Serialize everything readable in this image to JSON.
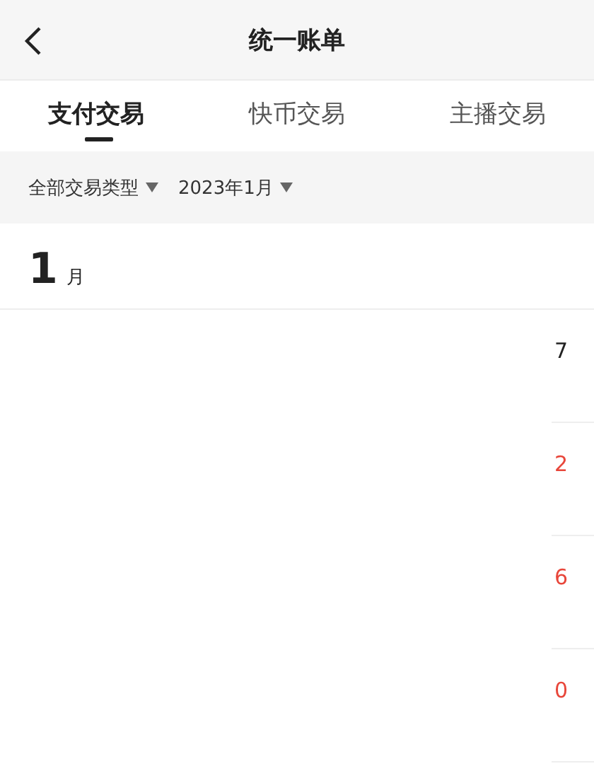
{
  "header": {
    "title": "统一账单"
  },
  "tabs": [
    {
      "label": "支付交易",
      "selected": true
    },
    {
      "label": "快币交易",
      "selected": false
    },
    {
      "label": "主播交易",
      "selected": false
    }
  ],
  "filters": [
    {
      "label": "全部交易类型"
    },
    {
      "label": "2023年1月"
    }
  ],
  "month": {
    "number": "1",
    "unit": "月"
  },
  "rows": [
    {
      "amount": "7",
      "color": "#222222"
    },
    {
      "amount": "2",
      "color": "#e8463a"
    },
    {
      "amount": "6",
      "color": "#e8463a"
    },
    {
      "amount": "0",
      "color": "#e8463a"
    }
  ]
}
